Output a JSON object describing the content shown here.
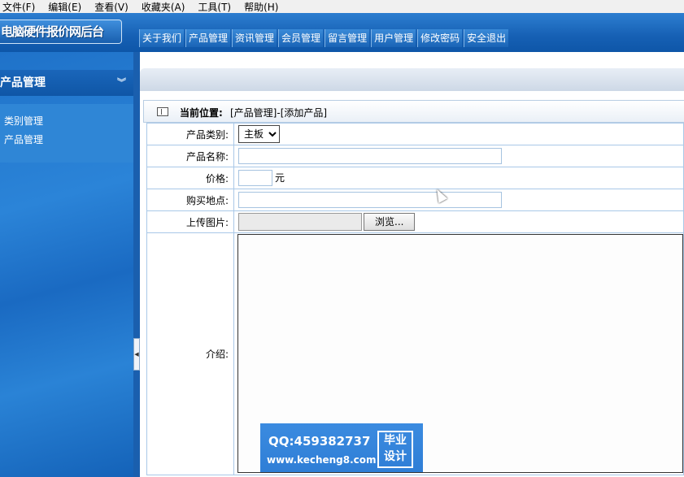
{
  "menubar": [
    "文件(F)",
    "编辑(E)",
    "查看(V)",
    "收藏夹(A)",
    "工具(T)",
    "帮助(H)"
  ],
  "header": {
    "logo_text": "电脑硬件报价网后台",
    "nav": [
      "关于我们",
      "产品管理",
      "资讯管理",
      "会员管理",
      "留言管理",
      "用户管理",
      "修改密码",
      "安全退出"
    ]
  },
  "sidebar": {
    "title": "产品管理",
    "toggle_icon": "chevron-double-down-icon",
    "items": [
      "类别管理",
      "产品管理"
    ]
  },
  "breadcrumb": {
    "label": "当前位置:",
    "path": "[产品管理]-[添加产品]"
  },
  "form": {
    "category_label": "产品类别:",
    "category_value": "主板",
    "name_label": "产品名称:",
    "name_value": "",
    "price_label": "价格:",
    "price_value": "",
    "price_unit": "元",
    "location_label": "购买地点:",
    "location_value": "",
    "upload_label": "上传图片:",
    "browse_label": "浏览...",
    "intro_label": "介绍:"
  },
  "watermark": {
    "qq": "QQ:459382737",
    "url": "www.kecheng8.com",
    "badge_line1": "毕业",
    "badge_line2": "设计"
  },
  "colors": {
    "header_blue": "#1660b4",
    "sidebar_blue": "#2b84d8",
    "table_border": "#a9c8e8"
  }
}
